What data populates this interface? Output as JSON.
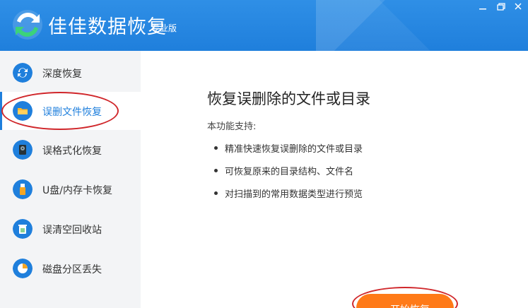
{
  "app": {
    "title": "佳佳数据恢复",
    "edition": "专业版"
  },
  "window_controls": [
    "minimize",
    "maximize",
    "close"
  ],
  "sidebar": {
    "items": [
      {
        "label": "深度恢复",
        "icon": "refresh-icon",
        "active": false
      },
      {
        "label": "误删文件恢复",
        "icon": "folder-icon",
        "active": true
      },
      {
        "label": "误格式化恢复",
        "icon": "disk-icon",
        "active": false
      },
      {
        "label": "U盘/内存卡恢复",
        "icon": "usb-icon",
        "active": false
      },
      {
        "label": "误清空回收站",
        "icon": "recycle-bin-icon",
        "active": false
      },
      {
        "label": "磁盘分区丢失",
        "icon": "partition-icon",
        "active": false
      }
    ]
  },
  "main": {
    "heading": "恢复误删除的文件或目录",
    "support_label": "本功能支持:",
    "features": [
      "精准快速恢复误删除的文件或目录",
      "可恢复原来的目录结构、文件名",
      "对扫描到的常用数据类型进行预览"
    ],
    "start_button": "开始恢复"
  },
  "colors": {
    "titlebar": "#1f7fdc",
    "sidebar_bg": "#f3f4f6",
    "accent": "#1f7fdc",
    "button": "#ff7a18",
    "annotation": "#d0272b"
  }
}
